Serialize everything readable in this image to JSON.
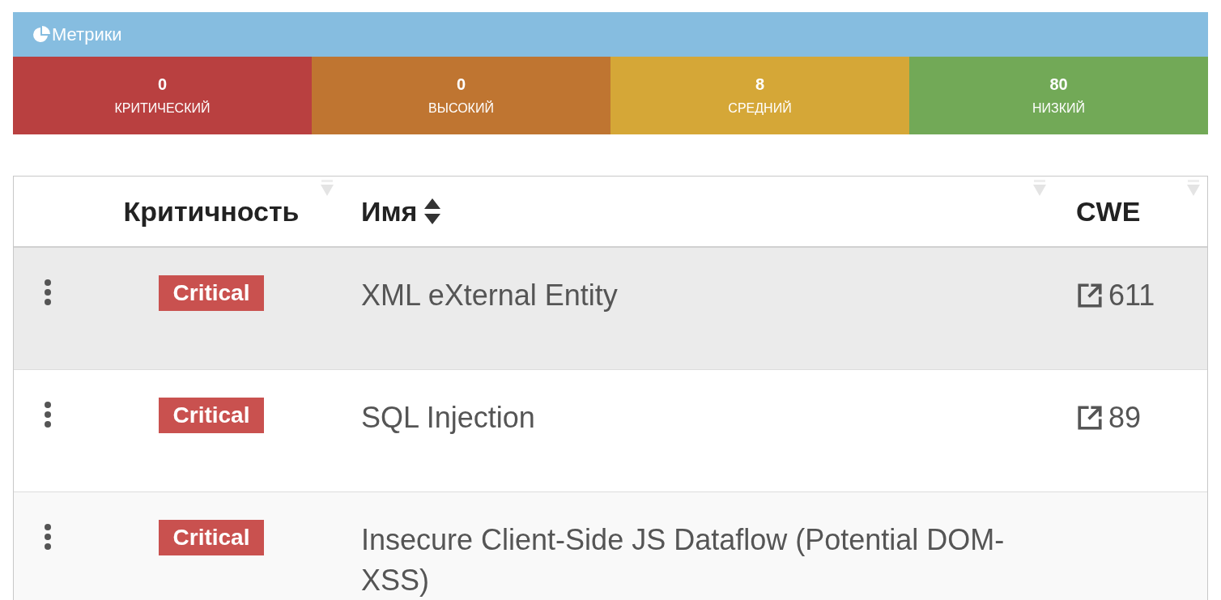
{
  "metrics": {
    "title": "Метрики",
    "tiles": [
      {
        "value": "0",
        "label": "КРИТИЧЕСКИЙ",
        "color": "#b94040"
      },
      {
        "value": "0",
        "label": "ВЫСОКИЙ",
        "color": "#bf7531"
      },
      {
        "value": "8",
        "label": "СРЕДНИЙ",
        "color": "#d5a737"
      },
      {
        "value": "80",
        "label": "НИЗКИЙ",
        "color": "#72a957"
      }
    ]
  },
  "table": {
    "columns": [
      {
        "label": "Критичность",
        "sorted": false
      },
      {
        "label": "Имя",
        "sorted": true
      },
      {
        "label": "CWE",
        "sorted": false
      }
    ],
    "rows": [
      {
        "severity": "Critical",
        "name": "XML eXternal Entity",
        "cwe": "611",
        "selected": true
      },
      {
        "severity": "Critical",
        "name": "SQL Injection",
        "cwe": "89",
        "selected": false
      },
      {
        "severity": "Critical",
        "name": "Insecure Client-Side JS Dataflow (Potential DOM-XSS)",
        "selected": false
      }
    ]
  }
}
